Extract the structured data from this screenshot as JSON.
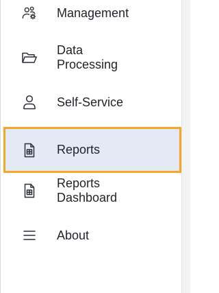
{
  "sidebar": {
    "items": [
      {
        "label": "Management",
        "icon": "users-gear-icon",
        "active": false
      },
      {
        "label": "Data\nProcessing",
        "icon": "folder-open-icon",
        "active": false
      },
      {
        "label": "Self-Service",
        "icon": "user-icon",
        "active": false
      },
      {
        "label": "Reports",
        "icon": "report-document-icon",
        "active": true
      },
      {
        "label": "Reports\nDashboard",
        "icon": "report-document-icon",
        "active": false
      },
      {
        "label": "About",
        "icon": "menu-lines-icon",
        "active": false
      }
    ]
  },
  "colors": {
    "active_background": "#e4e9f6",
    "active_border": "#f5a623",
    "text": "#1f2328"
  }
}
